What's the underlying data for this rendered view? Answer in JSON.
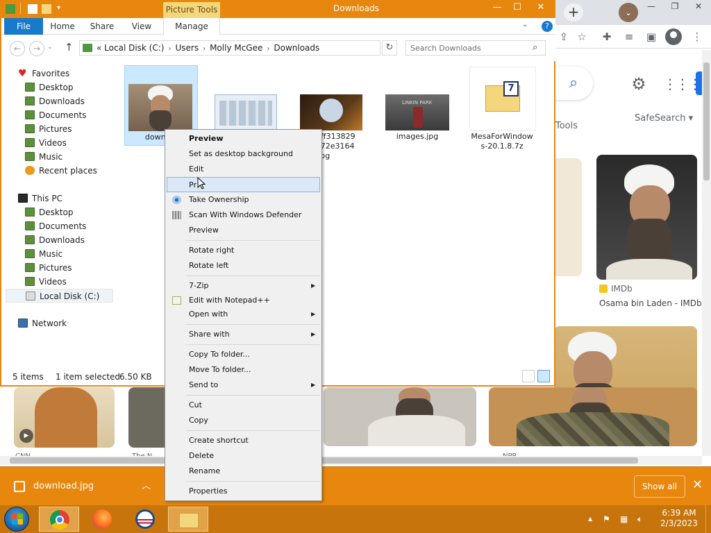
{
  "chrome": {
    "newtab_glyph": "+",
    "win_min": "—",
    "win_restore": "❐",
    "win_close": "✕",
    "tools_label": "Tools",
    "safesearch_label": "SafeSearch ▾",
    "imdb_source": "IMDb",
    "imdb_title": "Osama bin Laden - IMDb",
    "bottom_sources": [
      "CNN",
      "The N",
      "NPR"
    ]
  },
  "downloads_bar": {
    "file_name": "download.jpg",
    "show_all_label": "Show all",
    "close_glyph": "✕"
  },
  "explorer": {
    "picture_tools_label": "Picture Tools",
    "title": "Downloads",
    "win_min": "—",
    "win_max": "☐",
    "win_close": "✕",
    "ribbon_tabs": [
      "File",
      "Home",
      "Share",
      "View",
      "Manage"
    ],
    "help_glyph": "?",
    "breadcrumb": [
      "«",
      "Local Disk (C:)",
      "Users",
      "Molly McGee",
      "Downloads"
    ],
    "search_placeholder": "Search Downloads",
    "nav": {
      "favorites_header": "Favorites",
      "favorites": [
        "Desktop",
        "Downloads",
        "Documents",
        "Pictures",
        "Videos",
        "Music",
        "Recent places"
      ],
      "thispc_header": "This PC",
      "thispc": [
        "Desktop",
        "Documents",
        "Downloads",
        "Music",
        "Pictures",
        "Videos",
        "Local Disk (C:)"
      ],
      "network": "Network"
    },
    "files": [
      {
        "name": "downloa",
        "selected": true
      },
      {
        "name": "",
        "selected": false
      },
      {
        "name": "47ff313829 e972e3164 a.jpg",
        "line1": "47ff313829",
        "line2": "e972e3164",
        "line3": "a.jpg",
        "selected": false
      },
      {
        "name": "images.jpg",
        "selected": false
      },
      {
        "name": "MesaForWindows-20.1.8.7z",
        "line1": "MesaForWindow",
        "line2": "s-20.1.8.7z",
        "selected": false
      }
    ],
    "status": {
      "items": "5 items",
      "selected": "1 item selected",
      "size": "6.50 KB"
    }
  },
  "context_menu": {
    "items": [
      {
        "label": "Preview",
        "bold": true
      },
      {
        "label": "Set as desktop background"
      },
      {
        "label": "Edit"
      },
      {
        "label": "Pr",
        "hover": true
      },
      {
        "label": "Take Ownership",
        "icon": "ownership-icon"
      },
      {
        "label": "Scan With Windows Defender",
        "icon": "defender-icon"
      },
      {
        "label": "Preview"
      },
      {
        "label": "Rotate right"
      },
      {
        "label": "Rotate left"
      },
      {
        "label": "7-Zip",
        "submenu": true
      },
      {
        "label": "Edit with Notepad++",
        "icon": "notepad-icon"
      },
      {
        "label": "Open with",
        "submenu": true
      },
      {
        "label": "Share with",
        "submenu": true
      },
      {
        "label": "Copy To folder..."
      },
      {
        "label": "Move To folder..."
      },
      {
        "label": "Send to",
        "submenu": true
      },
      {
        "label": "Cut"
      },
      {
        "label": "Copy"
      },
      {
        "label": "Create shortcut"
      },
      {
        "label": "Delete"
      },
      {
        "label": "Rename"
      },
      {
        "label": "Properties"
      }
    ],
    "submenu_glyph": "▶"
  },
  "taskbar": {
    "time": "6:39 AM",
    "date": "2/3/2023",
    "tray_up_glyph": "▲"
  },
  "colors": {
    "accent_orange": "#e8870d",
    "taskbar": "#c6740b",
    "file_tab_blue": "#1979ca",
    "selection_blue": "#cce8ff"
  }
}
